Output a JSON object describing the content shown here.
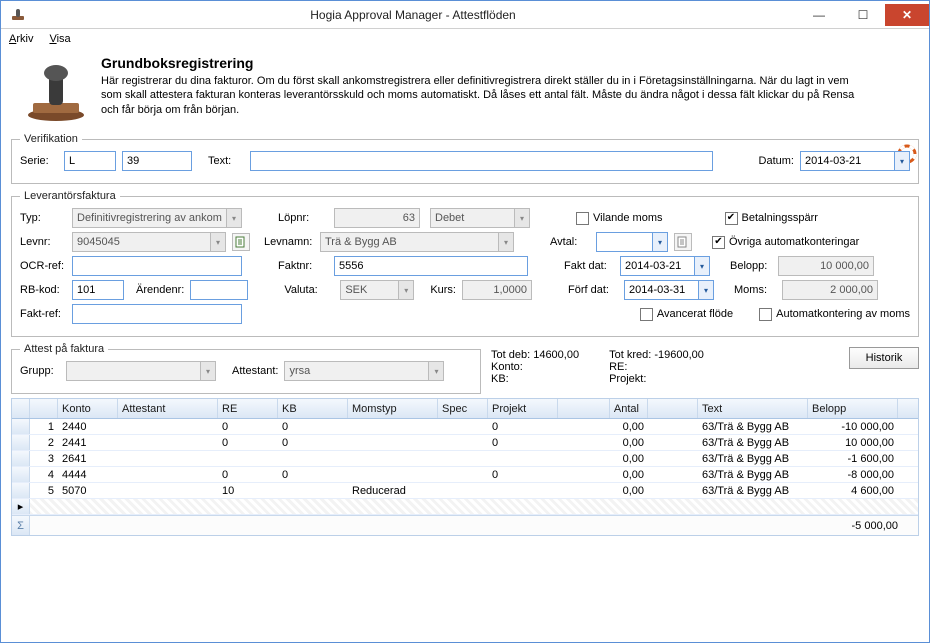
{
  "window": {
    "title": "Hogia Approval Manager - Attestflöden"
  },
  "menu": {
    "arkiv": "Arkiv",
    "visa": "Visa"
  },
  "header": {
    "title": "Grundboksregistrering",
    "body": "Här registrerar du dina fakturor. Om du först skall ankomstregistrera eller definitivregistrera direkt ställer du in i Företagsinställningarna. När du lagt in vem som skall attestera fakturan konteras leverantörsskuld och moms automatiskt. Då låses ett antal fält. Måste du ändra något i dessa fält klickar du på Rensa och får börja om från början."
  },
  "verifikation": {
    "legend": "Verifikation",
    "serie_label": "Serie:",
    "serie_value": "L",
    "serie_num": "39",
    "text_label": "Text:",
    "text_value": "",
    "datum_label": "Datum:",
    "datum_value": "2014-03-21"
  },
  "lev": {
    "legend": "Leverantörsfaktura",
    "typ_label": "Typ:",
    "typ_value": "Definitivregistrering av ankomstf",
    "lopnr_label": "Löpnr:",
    "lopnr_value": "63",
    "debkred_value": "Debet",
    "vilande_moms": "Vilande moms",
    "betalsparr": "Betalningsspärr",
    "levnr_label": "Levnr:",
    "levnr_value": "9045045",
    "levnamn_label": "Levnamn:",
    "levnamn_value": "Trä & Bygg AB",
    "avtal_label": "Avtal:",
    "avtal_value": "",
    "ovriga_auto": "Övriga automatkonteringar",
    "ocr_label": "OCR-ref:",
    "ocr_value": "",
    "faktnr_label": "Faktnr:",
    "faktnr_value": "5556",
    "faktdat_label": "Fakt dat:",
    "faktdat_value": "2014-03-21",
    "belopp_label": "Belopp:",
    "belopp_value": "10 000,00",
    "rbkod_label": "RB-kod:",
    "rbkod_value": "101",
    "arendenr_label": "Ärendenr:",
    "arendenr_value": "",
    "valuta_label": "Valuta:",
    "valuta_value": "SEK",
    "kurs_label": "Kurs:",
    "kurs_value": "1,0000",
    "forfdat_label": "Förf dat:",
    "forfdat_value": "2014-03-31",
    "moms_label": "Moms:",
    "moms_value": "2 000,00",
    "faktref_label": "Fakt-ref:",
    "faktref_value": "",
    "avancerat_flode": "Avancerat flöde",
    "automatkont_moms": "Automatkontering av moms"
  },
  "attest": {
    "legend": "Attest på faktura",
    "grupp_label": "Grupp:",
    "grupp_value": "",
    "attestant_label": "Attestant:",
    "attestant_value": "yrsa"
  },
  "totals": {
    "tot_deb_label": "Tot deb:",
    "tot_deb_value": "14600,00",
    "konto_label": "Konto:",
    "kb_label": "KB:",
    "tot_kred_label": "Tot kred:",
    "tot_kred_value": "-19600,00",
    "re_label": "RE:",
    "projekt_label": "Projekt:",
    "historik": "Historik"
  },
  "grid": {
    "headers": [
      "",
      "",
      "Konto",
      "Attestant",
      "RE",
      "KB",
      "Momstyp",
      "Spec",
      "Projekt",
      "Antal",
      "",
      "Text",
      "Belopp"
    ],
    "header_antal": "Antal",
    "header_text": "Text",
    "rows": [
      {
        "n": "1",
        "konto": "2440",
        "attestant": "",
        "re": "0",
        "kb": "0",
        "momstyp": "",
        "spec": "",
        "projekt": "0",
        "antal": "0,00",
        "text": "63/Trä & Bygg AB",
        "belopp": "-10 000,00"
      },
      {
        "n": "2",
        "konto": "2441",
        "attestant": "",
        "re": "0",
        "kb": "0",
        "momstyp": "",
        "spec": "",
        "projekt": "0",
        "antal": "0,00",
        "text": "63/Trä & Bygg AB",
        "belopp": "10 000,00"
      },
      {
        "n": "3",
        "konto": "2641",
        "attestant": "",
        "re": "",
        "kb": "",
        "momstyp": "",
        "spec": "",
        "projekt": "",
        "antal": "0,00",
        "text": "63/Trä & Bygg AB",
        "belopp": "-1 600,00"
      },
      {
        "n": "4",
        "konto": "4444",
        "attestant": "",
        "re": "0",
        "kb": "0",
        "momstyp": "",
        "spec": "",
        "projekt": "0",
        "antal": "0,00",
        "text": "63/Trä & Bygg AB",
        "belopp": "-8 000,00"
      },
      {
        "n": "5",
        "konto": "5070",
        "attestant": "",
        "re": "10",
        "kb": "",
        "momstyp": "Reducerad",
        "spec": "",
        "projekt": "",
        "antal": "0,00",
        "text": "63/Trä & Bygg AB",
        "belopp": "4 600,00"
      }
    ],
    "sum_belopp": "-5 000,00",
    "sigma": "Σ",
    "new_marker": "▸"
  }
}
